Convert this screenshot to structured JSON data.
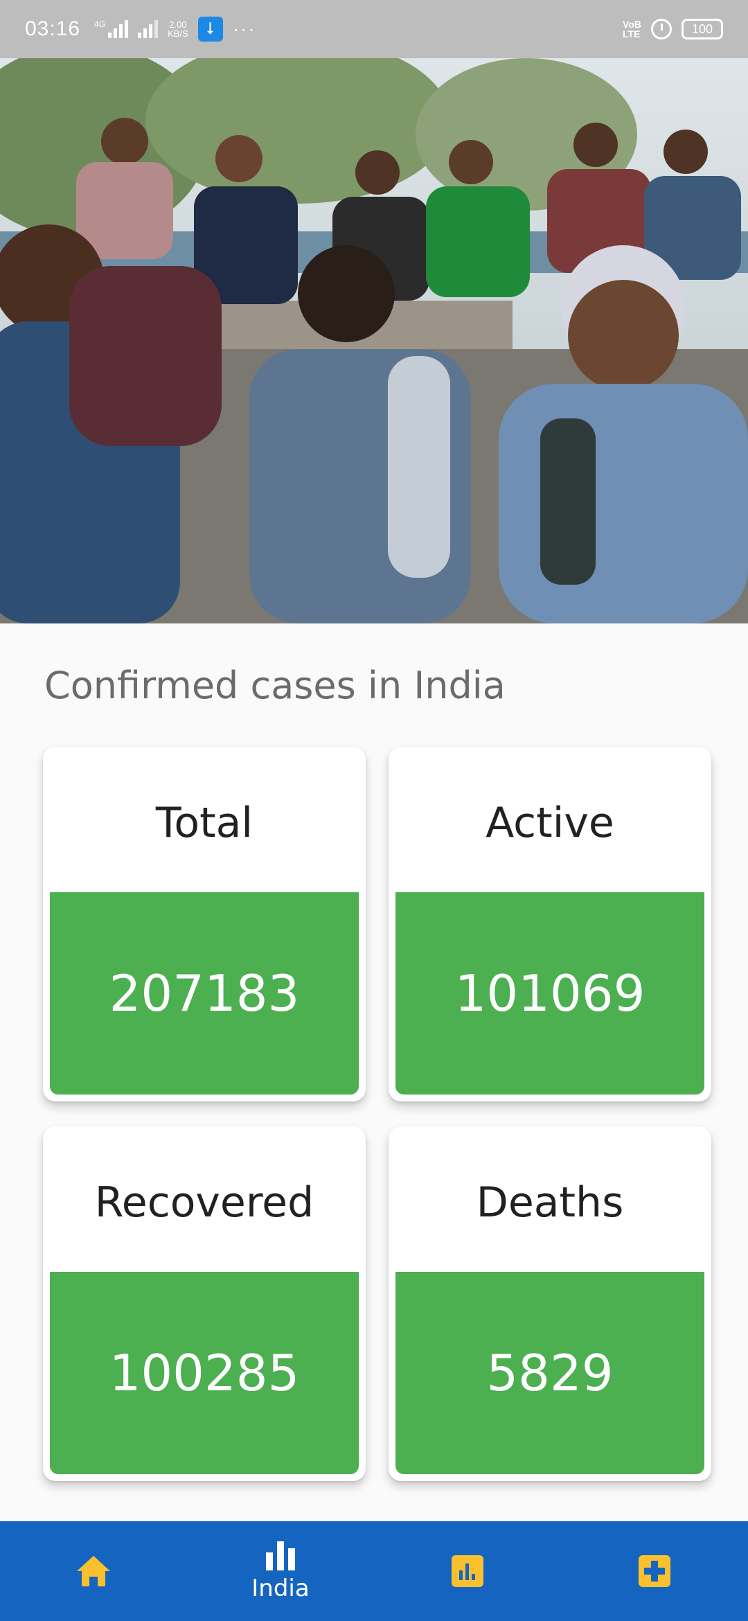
{
  "status_bar": {
    "time": "03:16",
    "network_tag": "4G",
    "speed_value": "2.00",
    "speed_unit": "KB/S",
    "volte_top": "VoB",
    "volte_bottom": "LTE",
    "battery": "100",
    "more_dots": "···",
    "icons": [
      "signal-icon",
      "usb-icon",
      "alarm-icon",
      "battery-icon"
    ]
  },
  "hero": {
    "image_subject": "hero-photo"
  },
  "main": {
    "title": "Confirmed cases in India",
    "cards": [
      {
        "label": "Total",
        "value": "207183"
      },
      {
        "label": "Active",
        "value": "101069"
      },
      {
        "label": "Recovered",
        "value": "100285"
      },
      {
        "label": "Deaths",
        "value": "5829"
      }
    ],
    "accent_color": "#4caf50"
  },
  "bottom_nav": {
    "background": "#1565c0",
    "icon_color": "#fbc02d",
    "items": [
      {
        "icon": "home-icon",
        "label": ""
      },
      {
        "icon": "bar-chart-icon",
        "label": "India"
      },
      {
        "icon": "stats-box-icon",
        "label": ""
      },
      {
        "icon": "medical-cross-icon",
        "label": ""
      }
    ]
  }
}
